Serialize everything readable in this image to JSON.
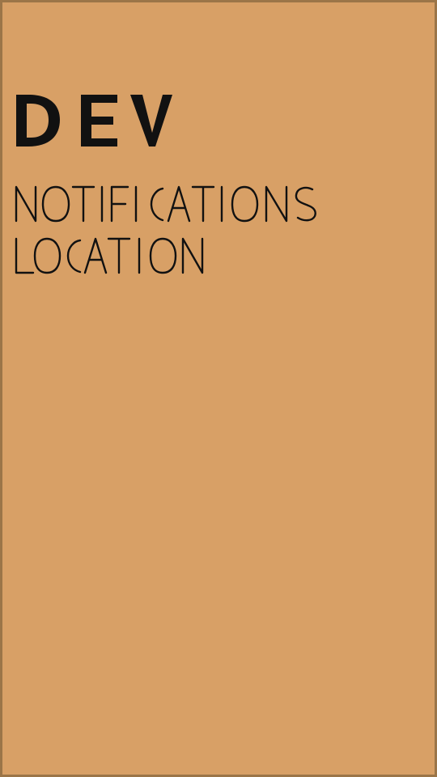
{
  "screen": {
    "title": "DEV",
    "menu": [
      {
        "label": "NOTIFICATIONS"
      },
      {
        "label": "LOCATION"
      }
    ]
  },
  "colors": {
    "background": "#d8a066",
    "border": "#9b7548",
    "text": "#111111"
  }
}
